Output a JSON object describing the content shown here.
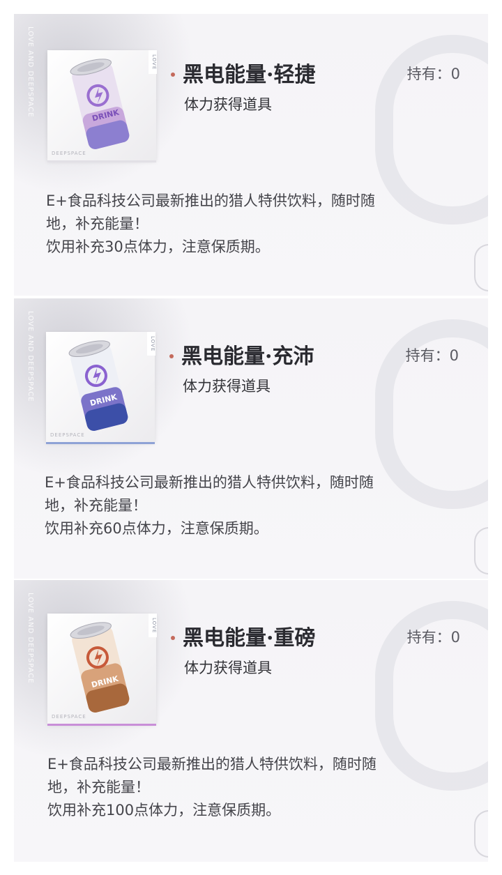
{
  "items": [
    {
      "side_text": "LOVE AND DEEPSPACE",
      "title": "黑电能量·轻捷",
      "subtitle": "体力获得道具",
      "owned": "持有：0",
      "desc_line1": "E+食品科技公司最新推出的猎人特供饮料，随时随",
      "desc_line2": "地，补充能量！",
      "desc_line3": "饮用补充30点体力，注意保质期。",
      "image_tag": "DEEPSPACE",
      "vtag": "LOVE",
      "can_label": "DRINK",
      "icon": "drink-can-purple-icon",
      "accent": "#a48cc8"
    },
    {
      "side_text": "LOVE AND DEEPSPACE",
      "title": "黑电能量·充沛",
      "subtitle": "体力获得道具",
      "owned": "持有：0",
      "desc_line1": "E+食品科技公司最新推出的猎人特供饮料，随时随",
      "desc_line2": "地，补充能量！",
      "desc_line3": "饮用补充60点体力，注意保质期。",
      "image_tag": "DEEPSPACE",
      "vtag": "LOVE",
      "can_label": "DRINK",
      "icon": "drink-can-blue-icon",
      "accent": "#8ea2d6"
    },
    {
      "side_text": "LOVE AND DEEPSPACE",
      "title": "黑电能量·重磅",
      "subtitle": "体力获得道具",
      "owned": "持有：0",
      "desc_line1": "E+食品科技公司最新推出的猎人特供饮料，随时随",
      "desc_line2": "地，补充能量！",
      "desc_line3": "饮用补充100点体力，注意保质期。",
      "image_tag": "DEEPSPACE",
      "vtag": "LOVE",
      "can_label": "DRINK",
      "icon": "drink-can-gold-icon",
      "accent": "#c98fd8"
    }
  ]
}
